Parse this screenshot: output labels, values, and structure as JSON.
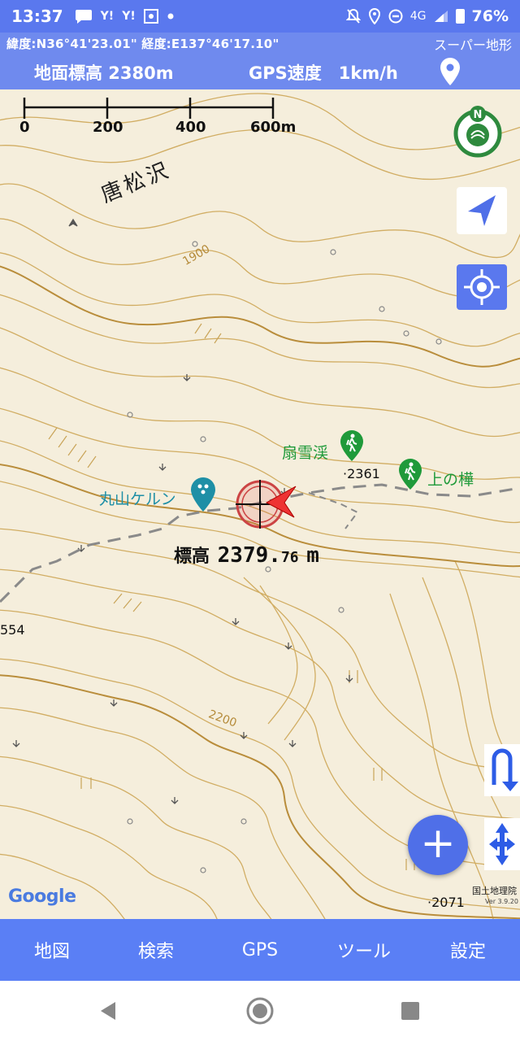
{
  "status": {
    "time": "13:37",
    "left_icons": [
      "message-icon",
      "yahoo-icon",
      "yahoo-icon",
      "weather-icon",
      "dot-icon"
    ],
    "yahoo_label": "Y!",
    "network": "4G",
    "battery": "76%"
  },
  "header": {
    "coords": "緯度:N36°41'23.01\"  経度:E137°46'17.10\"",
    "app_name": "スーパー地形",
    "ground_elevation": "地面標高 2380m",
    "gps_speed": "GPS速度　1km/h"
  },
  "map": {
    "scale_labels": [
      "0",
      "200",
      "400",
      "600m"
    ],
    "place_label": "唐松沢",
    "contour_label_1900": "1900",
    "contour_label_2200": "2200",
    "poi": {
      "senxetsukei": "扇雪渓",
      "kaminokanba": "上の樺",
      "maruyama": "丸山ケルン"
    },
    "spot_heights": {
      "h2361": "·2361",
      "h2071": "·2071",
      "h554": "554"
    },
    "elevation_readout": {
      "label": "標高",
      "integer": "2379.",
      "decimal": "76",
      "unit": "m"
    },
    "attribution": {
      "google": "Google",
      "gsi": "国土地理院",
      "version": "Ver 3.9.20"
    },
    "colors": {
      "contour": "#c9a458",
      "contour_index": "#b58b3a",
      "trail": "#7a7a7a",
      "accent": "#5a78ee",
      "poi_green": "#1f9a3a",
      "poi_teal": "#1e8fa6",
      "compass_green": "#2e8a3e"
    }
  },
  "menu": {
    "tabs": [
      "地図",
      "検索",
      "GPS",
      "ツール",
      "設定"
    ]
  }
}
